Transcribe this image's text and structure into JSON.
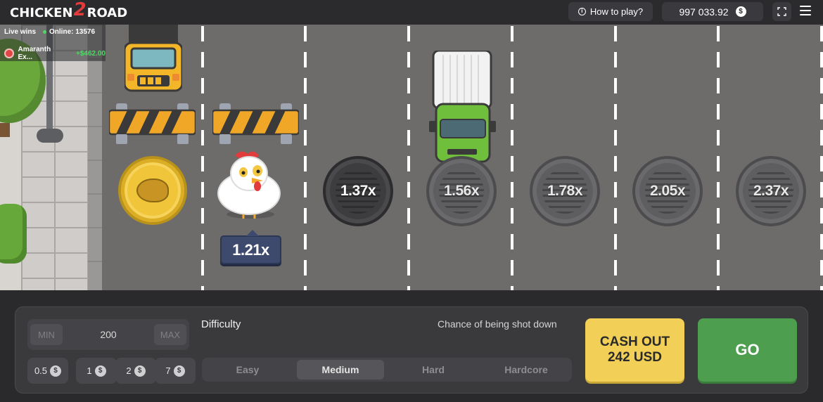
{
  "header": {
    "logo_text_left": "CHICKEN",
    "logo_text_mid": "2",
    "logo_text_right": "ROAD",
    "how_to_play": "How to play?",
    "balance": "997 033.92",
    "currency_symbol": "$"
  },
  "live_wins": {
    "label": "Live wins",
    "online": "Online: 13576",
    "last_winner": "Amaranth Ex...",
    "last_amount": "+$462.00"
  },
  "lanes": {
    "current_multiplier": "1.21x",
    "multipliers": [
      "1.37x",
      "1.56x",
      "1.78x",
      "2.05x",
      "2.37x"
    ]
  },
  "controls": {
    "min_label": "MIN",
    "max_label": "MAX",
    "bet_value": "200",
    "quick_bets": [
      "0.5",
      "1",
      "2",
      "7"
    ],
    "difficulty_label": "Difficulty",
    "chance_label": "Chance of being shot down",
    "difficulty_options": [
      "Easy",
      "Medium",
      "Hard",
      "Hardcore"
    ],
    "difficulty_selected": "Medium",
    "cashout_line1": "CASH OUT",
    "cashout_line2": "242 USD",
    "go_label": "GO"
  },
  "colors": {
    "cashout": "#f2cf56",
    "go": "#4e9e4f",
    "online_dot": "#4cd964",
    "tag": "#3e4a6d"
  }
}
